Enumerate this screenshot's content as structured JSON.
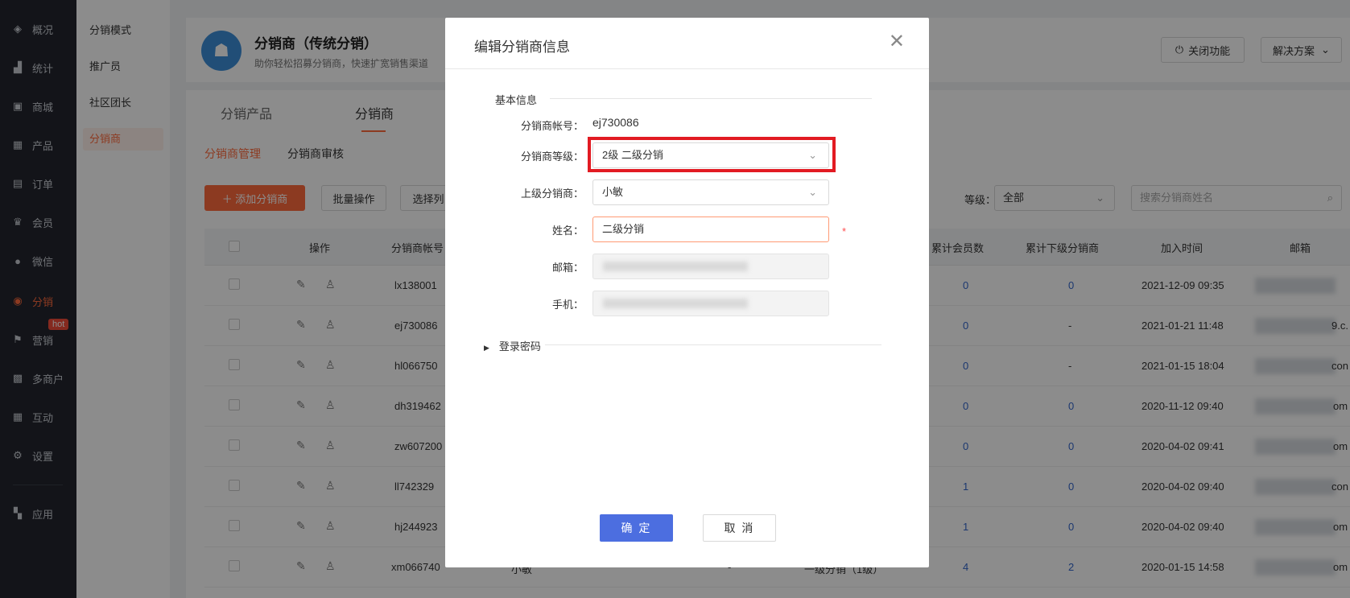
{
  "nav": {
    "items": [
      {
        "icon": "layers-icon",
        "glyph": "◈",
        "label": "概况"
      },
      {
        "icon": "chart-icon",
        "glyph": "▟",
        "label": "统计"
      },
      {
        "icon": "store-icon",
        "glyph": "▣",
        "label": "商城"
      },
      {
        "icon": "grid-icon",
        "glyph": "▦",
        "label": "产品"
      },
      {
        "icon": "order-icon",
        "glyph": "▤",
        "label": "订单"
      },
      {
        "icon": "crown-icon",
        "glyph": "♛",
        "label": "会员"
      },
      {
        "icon": "wechat-icon",
        "glyph": "●",
        "label": "微信"
      },
      {
        "icon": "users-icon",
        "glyph": "◉",
        "label": "分销"
      },
      {
        "icon": "flag-icon",
        "glyph": "⚑",
        "label": "营销"
      },
      {
        "icon": "merchant-icon",
        "glyph": "▩",
        "label": "多商户"
      },
      {
        "icon": "interact-icon",
        "glyph": "▦",
        "label": "互动"
      },
      {
        "icon": "gear-icon",
        "glyph": "⚙",
        "label": "设置"
      },
      {
        "icon": "apps-icon",
        "glyph": "▚",
        "label": "应用"
      }
    ],
    "hot_badge": "hot"
  },
  "subnav": {
    "items": [
      "分销模式",
      "推广员",
      "社区团长",
      "分销商"
    ]
  },
  "header": {
    "title": "分销商（传统分销）",
    "subtitle": "助你轻松招募分销商，快速扩宽销售渠道",
    "close_feature": "关闭功能",
    "solutions": "解决方案"
  },
  "tabs": [
    "分销产品",
    "分销商"
  ],
  "subtabs": [
    "分销商管理",
    "分销商审核"
  ],
  "toolbar": {
    "add": "＋ 添加分销商",
    "batch": "批量操作",
    "choose_cols": "选择列",
    "level_label": "等级：",
    "level_value": "全部",
    "search_placeholder": "搜索分销商姓名"
  },
  "table": {
    "headers": {
      "op": "操作",
      "account": "分销商帐号",
      "members": "累计会员数",
      "sub_distributors": "累计下级分销商",
      "joined": "加入时间",
      "email": "邮箱"
    },
    "rows": [
      {
        "account": "lx138001",
        "members": "0",
        "sub": "0",
        "joined": "2021-12-09 09:35",
        "email_tail": ""
      },
      {
        "account": "ej730086",
        "members": "0",
        "sub": "-",
        "joined": "2021-01-21 11:48",
        "email_tail": "9.c."
      },
      {
        "account": "hl066750",
        "members": "0",
        "sub": "-",
        "joined": "2021-01-15 18:04",
        "email_tail": "con"
      },
      {
        "account": "dh319462",
        "members": "0",
        "sub": "0",
        "joined": "2020-11-12 09:40",
        "email_tail": "om"
      },
      {
        "account": "zw607200",
        "members": "0",
        "sub": "0",
        "joined": "2020-04-02 09:41",
        "email_tail": "om"
      },
      {
        "account": "ll742329",
        "members": "1",
        "sub": "0",
        "joined": "2020-04-02 09:40",
        "email_tail": "con"
      },
      {
        "account": "hj244923",
        "members": "1",
        "sub": "0",
        "joined": "2020-04-02 09:40",
        "email_tail": "om"
      },
      {
        "account": "xm066740",
        "members": "4",
        "sub": "2",
        "joined": "2020-01-15 14:58",
        "email_tail": "om"
      }
    ],
    "last_row_parent": "小敏",
    "last_row_dash": "-",
    "last_row_level": "一级分销（1级）"
  },
  "modal": {
    "title": "编辑分销商信息",
    "section_basic": "基本信息",
    "account_label": "分销商帐号：",
    "account_value": "ej730086",
    "level_label": "分销商等级：",
    "level_value": "2级 二级分销",
    "parent_label": "上级分销商：",
    "parent_value": "小敏",
    "name_label": "姓名：",
    "name_value": "二级分销",
    "required_mark": "*",
    "email_label": "邮箱：",
    "phone_label": "手机：",
    "password_section": "登录密码",
    "confirm": "确 定",
    "cancel": "取 消"
  },
  "colors": {
    "accent": "#ff6a3d",
    "primary_button": "#4c6ee0",
    "highlight_box": "#e21b22",
    "sidebar": "#23262e"
  }
}
